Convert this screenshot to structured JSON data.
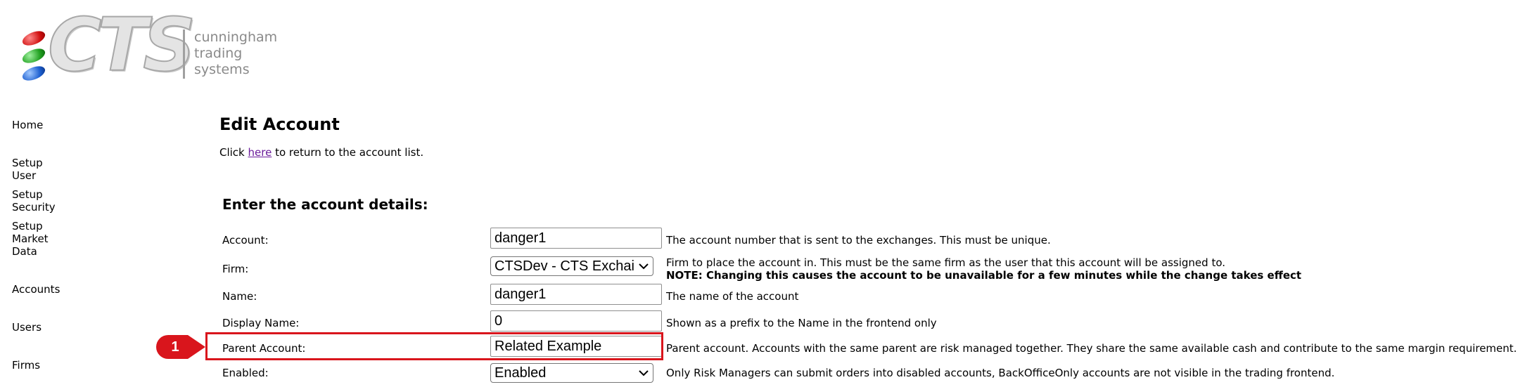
{
  "logo": {
    "wordmark": "CTS",
    "tagline": [
      "cunningham",
      "trading",
      "systems"
    ]
  },
  "nav": {
    "items": [
      "Home",
      "Setup\nUser",
      "Setup\nSecurity",
      "Setup\nMarket\nData",
      "Accounts",
      "Users",
      "Firms"
    ]
  },
  "page": {
    "title": "Edit Account",
    "intro_before": "Click ",
    "intro_link": "here",
    "intro_after": " to return to the account list.",
    "section_title": "Enter the account details:"
  },
  "form": {
    "account": {
      "label": "Account:",
      "value": "danger1",
      "desc": "The account number that is sent to the exchanges. This must be unique."
    },
    "firm": {
      "label": "Firm:",
      "value": "CTSDev - CTS Exchai",
      "desc": "Firm to place the account in. This must be the same firm as the user that this account will be assigned to.",
      "note": "NOTE: Changing this causes the account to be unavailable for a few minutes while the change takes effect"
    },
    "name": {
      "label": "Name:",
      "value": "danger1",
      "desc": "The name of the account"
    },
    "display_name": {
      "label": "Display Name:",
      "value": "0",
      "desc": "Shown as a prefix to the Name in the frontend only"
    },
    "parent_account": {
      "label": "Parent Account:",
      "value": "Related Example",
      "desc": "Parent account. Accounts with the same parent are risk managed together. They share the same available cash and contribute to the same margin requirement."
    },
    "enabled": {
      "label": "Enabled:",
      "value": "Enabled",
      "desc": "Only Risk Managers can submit orders into disabled accounts, BackOfficeOnly accounts are not visible in the trading frontend."
    }
  },
  "annotation": {
    "step_number": "1",
    "color": "#d9151c"
  }
}
